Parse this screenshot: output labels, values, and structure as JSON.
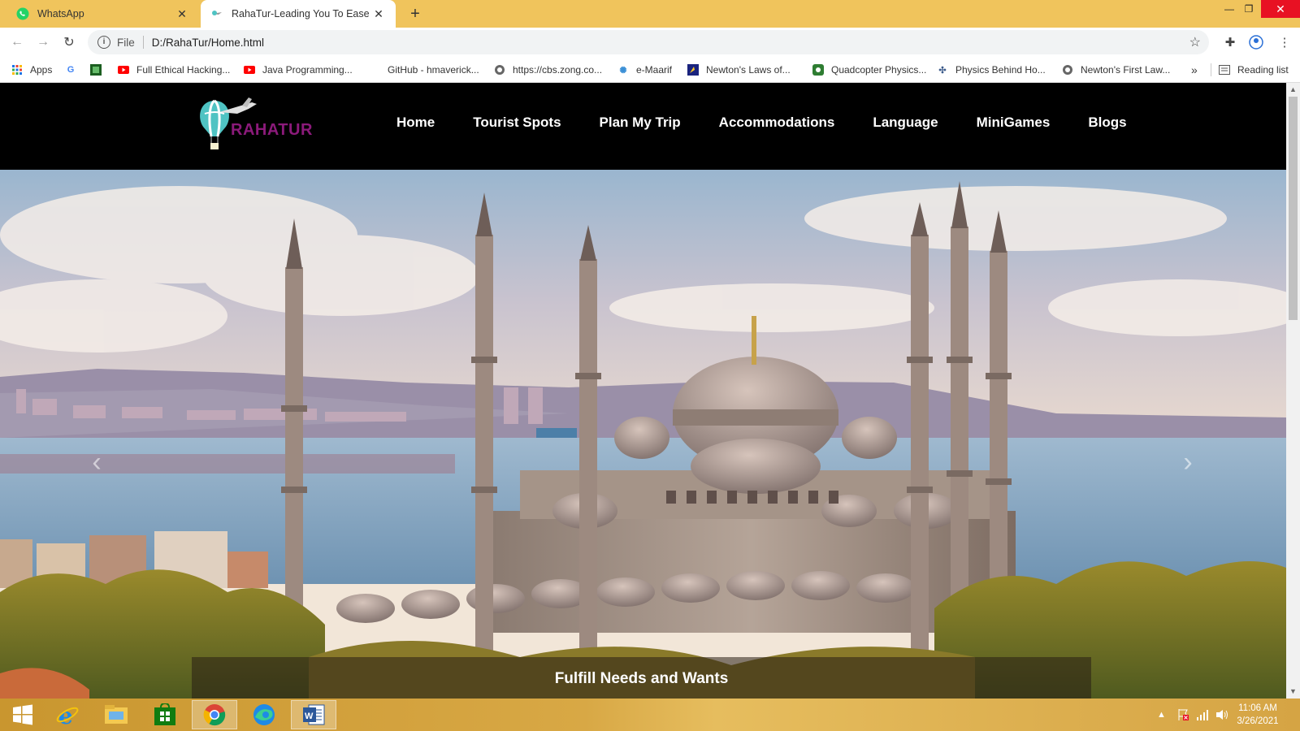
{
  "browser": {
    "tabs": [
      {
        "title": "WhatsApp",
        "active": false
      },
      {
        "title": "RahaTur-Leading You To Ease",
        "active": true
      }
    ],
    "address": {
      "scheme": "File",
      "url": "D:/RahaTur/Home.html"
    },
    "bookmarks": [
      {
        "label": "Apps"
      },
      {
        "label": ""
      },
      {
        "label": ""
      },
      {
        "label": "Full Ethical Hacking..."
      },
      {
        "label": "Java Programming..."
      },
      {
        "label": "GitHub - hmaverick..."
      },
      {
        "label": "https://cbs.zong.co..."
      },
      {
        "label": "e-Maarif"
      },
      {
        "label": "Newton's Laws of..."
      },
      {
        "label": "Quadcopter Physics..."
      },
      {
        "label": "Physics Behind Ho..."
      },
      {
        "label": "Newton's First Law..."
      }
    ],
    "overflow_label": "»",
    "reading_list": "Reading list"
  },
  "site": {
    "logo_text": "RAHATUR",
    "nav": [
      "Home",
      "Tourist Spots",
      "Plan My Trip",
      "Accommodations",
      "Language",
      "MiniGames",
      "Blogs"
    ],
    "hero": {
      "caption": "Fulfill Needs and Wants",
      "prev_arrow": "‹",
      "next_arrow": "›"
    }
  },
  "taskbar": {
    "time": "11:06 AM",
    "date": "3/26/2021",
    "apps": [
      "start-icon",
      "internet-explorer-icon",
      "file-explorer-icon",
      "store-icon",
      "chrome-icon",
      "edge-icon",
      "word-icon"
    ]
  },
  "colors": {
    "titlebar": "#f0c45c",
    "nav_bg": "#000000",
    "logo_accent": "#8b1a7a",
    "close_red": "#e81123"
  }
}
